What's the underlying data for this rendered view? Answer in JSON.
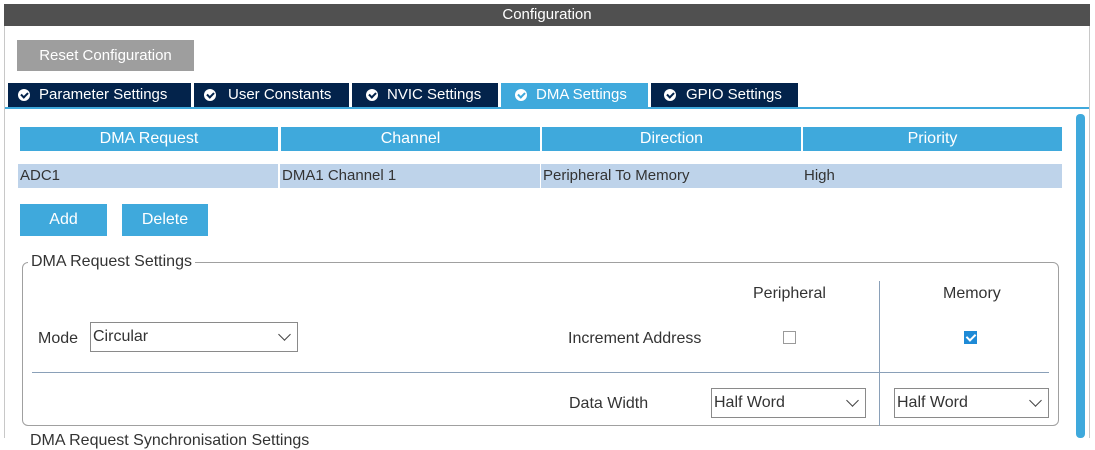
{
  "window": {
    "title": "Configuration"
  },
  "toolbar": {
    "reset_label": "Reset Configuration"
  },
  "tabs": [
    {
      "label": "Parameter Settings",
      "icon": "check-circle-icon",
      "active": false
    },
    {
      "label": "User Constants",
      "icon": "check-circle-icon",
      "active": false
    },
    {
      "label": "NVIC Settings",
      "icon": "check-circle-icon",
      "active": false
    },
    {
      "label": "DMA Settings",
      "icon": "check-circle-icon",
      "active": true
    },
    {
      "label": "GPIO Settings",
      "icon": "check-circle-icon",
      "active": false
    }
  ],
  "table": {
    "columns": [
      "DMA Request",
      "Channel",
      "Direction",
      "Priority"
    ],
    "rows": [
      [
        "ADC1",
        "DMA1 Channel 1",
        "Peripheral To Memory",
        "High"
      ]
    ]
  },
  "actions": {
    "add_label": "Add",
    "delete_label": "Delete"
  },
  "request_settings": {
    "legend": "DMA Request Settings",
    "peripheral_header": "Peripheral",
    "memory_header": "Memory",
    "mode_label": "Mode",
    "mode_value": "Circular",
    "increment_label": "Increment Address",
    "peripheral_increment": false,
    "memory_increment": true,
    "data_width_label": "Data Width",
    "peripheral_data_width": "Half Word",
    "memory_data_width": "Half Word"
  },
  "next_section_cut": "DMA Request Synchronisation Settings",
  "colors": {
    "accent": "#3fa9dc",
    "tab_dark": "#03234b",
    "row_selected": "#bed3ea",
    "title_bar": "#505050",
    "button_gray": "#9e9e9e",
    "checkbox_checked": "#1e8ad6"
  }
}
